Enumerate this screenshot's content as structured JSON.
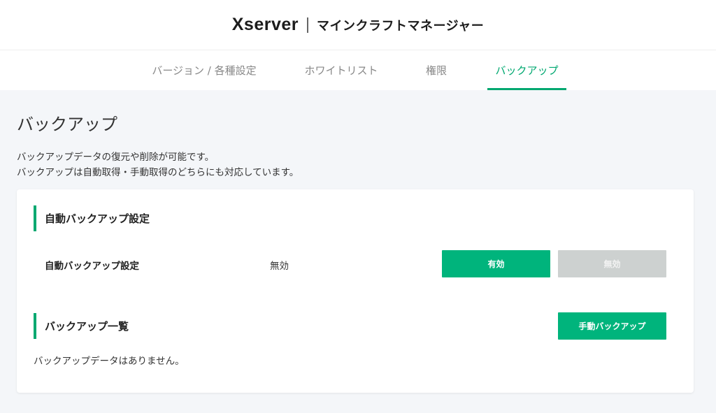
{
  "header": {
    "logo": "Xserver",
    "app_name": "マインクラフトマネージャー"
  },
  "tabs": [
    {
      "label": "バージョン / 各種設定",
      "active": false
    },
    {
      "label": "ホワイトリスト",
      "active": false
    },
    {
      "label": "権限",
      "active": false
    },
    {
      "label": "バックアップ",
      "active": true
    }
  ],
  "page": {
    "title": "バックアップ",
    "desc_line1": "バックアップデータの復元や削除が可能です。",
    "desc_line2": "バックアップは自動取得・手動取得のどちらにも対応しています。"
  },
  "auto_backup": {
    "section_title": "自動バックアップ設定",
    "row_label": "自動バックアップ設定",
    "status": "無効",
    "enable_label": "有効",
    "disable_label": "無効"
  },
  "backup_list": {
    "section_title": "バックアップ一覧",
    "manual_label": "手動バックアップ",
    "empty_message": "バックアップデータはありません。"
  },
  "colors": {
    "accent": "#00a870",
    "button_green": "#00b47c",
    "button_disabled": "#cdd1d0",
    "background": "#f4f6f9"
  }
}
